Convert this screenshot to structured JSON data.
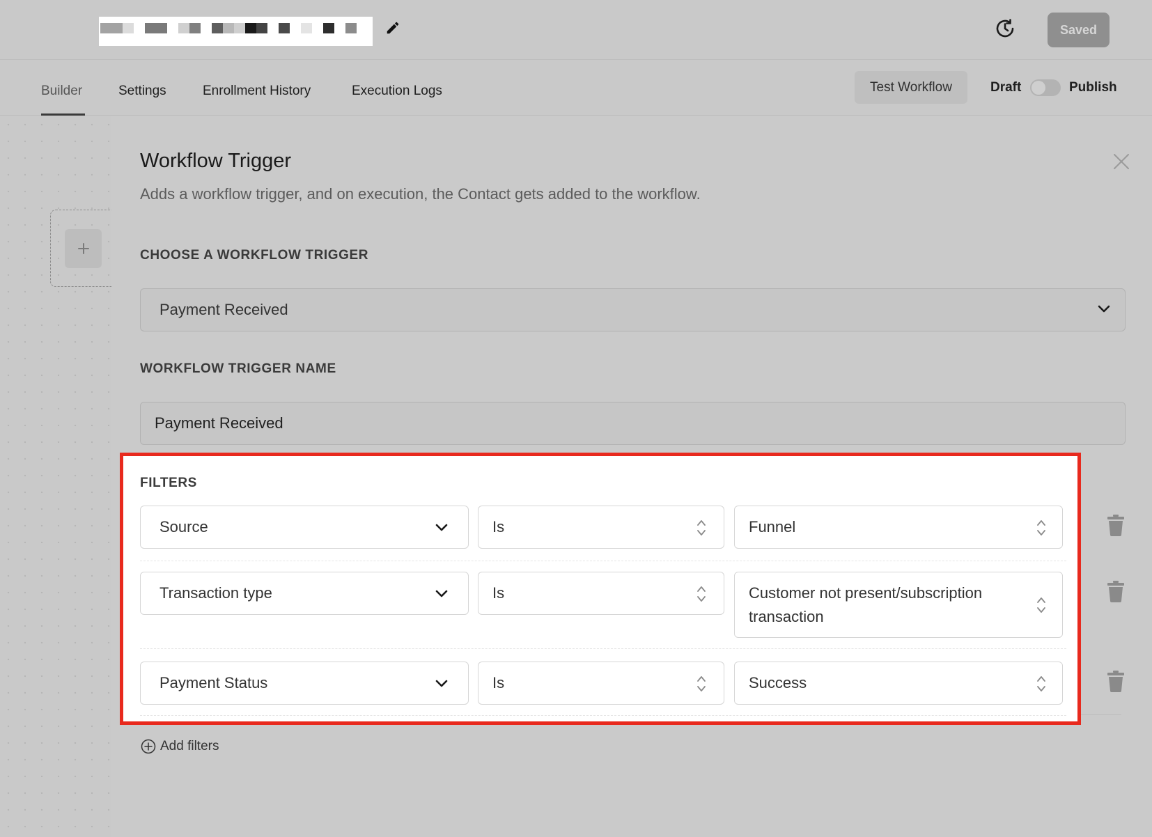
{
  "header": {
    "saved_label": "Saved"
  },
  "tabs": [
    {
      "label": "Builder",
      "active": true
    },
    {
      "label": "Settings",
      "active": false
    },
    {
      "label": "Enrollment History",
      "active": false
    },
    {
      "label": "Execution Logs",
      "active": false
    }
  ],
  "actions": {
    "test_workflow_label": "Test Workflow",
    "draft_label": "Draft",
    "publish_label": "Publish",
    "publish_toggle_on": false
  },
  "drawer": {
    "title": "Workflow Trigger",
    "subtitle": "Adds a workflow trigger, and on execution, the Contact gets added to the workflow.",
    "choose_trigger_label": "CHOOSE A WORKFLOW TRIGGER",
    "trigger_value": "Payment Received",
    "trigger_name_label": "WORKFLOW TRIGGER NAME",
    "trigger_name_value": "Payment Received",
    "filters_label": "FILTERS",
    "filters": [
      {
        "field": "Source",
        "operator": "Is",
        "value": "Funnel"
      },
      {
        "field": "Transaction type",
        "operator": "Is",
        "value": "Customer not present/subscription transaction"
      },
      {
        "field": "Payment Status",
        "operator": "Is",
        "value": "Success"
      }
    ],
    "add_filters_label": "Add filters"
  },
  "colors": {
    "highlight_border": "#e8291d",
    "saved_button_bg": "#8f8f8f"
  },
  "icons": [
    "pencil-icon",
    "history-icon",
    "plus-icon",
    "close-icon",
    "chevron-down-icon",
    "updown-icon",
    "trash-icon",
    "plus-circle-icon"
  ]
}
